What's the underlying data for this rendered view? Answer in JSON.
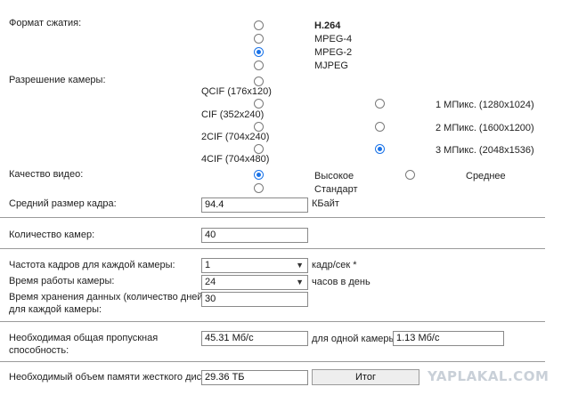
{
  "compression": {
    "label": "Формат сжатия:",
    "options": [
      "H.264",
      "MPEG-4",
      "MPEG-2",
      "MJPEG"
    ],
    "selected": "MPEG-2"
  },
  "resolution": {
    "label": "Разрешение камеры:",
    "left_options": [
      "QCIF (176x120)",
      "CIF (352x240)",
      "2CIF (704x240)",
      "4CIF (704x480)"
    ],
    "right_options": [
      "1 МПикс. (1280x1024)",
      "2 МПикс. (1600x1200)",
      "3 МПикс. (2048x1536)"
    ],
    "selected": "3 МПикс. (2048x1536)"
  },
  "quality": {
    "label": "Качество видео:",
    "options": [
      "Высокое",
      "Среднее",
      "Стандарт"
    ],
    "selected": "Высокое"
  },
  "frame_size": {
    "label": "Средний размер кадра:",
    "value": "94.4",
    "unit": "КБайт"
  },
  "camera_count": {
    "label": "Количество камер:",
    "value": "40"
  },
  "fps": {
    "label": "Частота кадров для каждой камеры:",
    "value": "1",
    "unit": "кадр/сек *"
  },
  "work_time": {
    "label": "Время работы камеры:",
    "value": "24",
    "unit": "часов в день"
  },
  "storage_days": {
    "label_line1": "Время хранения данных (количество дней)",
    "label_line2": "для каждой камеры:",
    "value": "30"
  },
  "bandwidth": {
    "label_line1": "Необходимая общая пропускная",
    "label_line2": "способность:",
    "total": "45.31 Мб/с",
    "per_camera_label": "для одной камеры:",
    "per_camera": "1.13 Мб/с"
  },
  "disk": {
    "label": "Необходимый объем памяти жесткого диска:",
    "value": "29.36 ТБ",
    "button": "Итог"
  },
  "watermark": "YAPLAKAL.COM"
}
